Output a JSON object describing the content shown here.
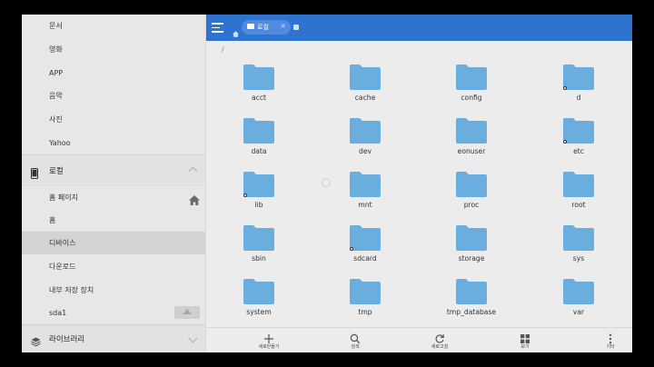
{
  "sidebar": {
    "top_items": [
      {
        "label": "문서"
      },
      {
        "label": "영화"
      },
      {
        "label": "APP"
      },
      {
        "label": "음악"
      },
      {
        "label": "사진"
      },
      {
        "label": "Yahoo"
      }
    ],
    "local_header": {
      "label": "로컬",
      "icon": "phone-icon"
    },
    "local_items": [
      {
        "label": "홈 페이지",
        "icon": "home-icon"
      },
      {
        "label": "홈"
      },
      {
        "label": "디바이스",
        "selected": true
      },
      {
        "label": "다운로드"
      },
      {
        "label": "내부 저장 장치"
      },
      {
        "label": "sda1",
        "icon": "eject-icon"
      }
    ],
    "library_header": {
      "label": "라이브러리",
      "icon": "layers-icon"
    }
  },
  "topbar": {
    "color": "#2f73d1",
    "tab_label": "로컬",
    "tab_close": "×"
  },
  "path": "/",
  "folders": [
    {
      "name": "acct",
      "link": false
    },
    {
      "name": "cache",
      "link": false
    },
    {
      "name": "config",
      "link": false
    },
    {
      "name": "d",
      "link": true
    },
    {
      "name": "data",
      "link": false
    },
    {
      "name": "dev",
      "link": false
    },
    {
      "name": "eonuser",
      "link": false
    },
    {
      "name": "etc",
      "link": true
    },
    {
      "name": "lib",
      "link": true
    },
    {
      "name": "mnt",
      "link": false
    },
    {
      "name": "proc",
      "link": false
    },
    {
      "name": "root",
      "link": false
    },
    {
      "name": "sbin",
      "link": false
    },
    {
      "name": "sdcard",
      "link": true
    },
    {
      "name": "storage",
      "link": false
    },
    {
      "name": "sys",
      "link": false
    },
    {
      "name": "system",
      "link": false
    },
    {
      "name": "tmp",
      "link": false
    },
    {
      "name": "tmp_database",
      "link": false
    },
    {
      "name": "var",
      "link": false
    }
  ],
  "folder_color": "#6aaee0",
  "toolbar": [
    {
      "label": "새로만들기",
      "icon": "plus-icon"
    },
    {
      "label": "검색",
      "icon": "search-icon"
    },
    {
      "label": "새로고침",
      "icon": "refresh-icon"
    },
    {
      "label": "보기",
      "icon": "grid-view-icon"
    },
    {
      "label": "기타",
      "icon": "more-vertical-icon"
    }
  ]
}
